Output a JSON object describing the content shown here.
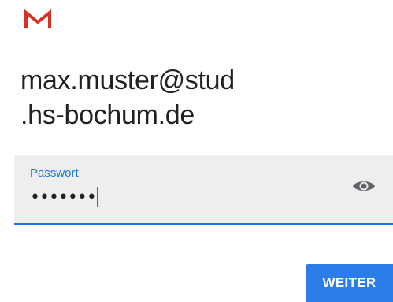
{
  "app": {
    "brand_icon": "gmail-m-icon",
    "brand_color": "#d93025"
  },
  "account": {
    "email_line1": "max.muster@stud",
    "email_line2": ".hs-bochum.de"
  },
  "password_field": {
    "label": "Passwort",
    "value_masked": "•••••••",
    "toggle_icon": "eye-icon",
    "accent_color": "#1a73e8"
  },
  "actions": {
    "next_label": "WEITER",
    "button_color": "#2b7de9"
  }
}
